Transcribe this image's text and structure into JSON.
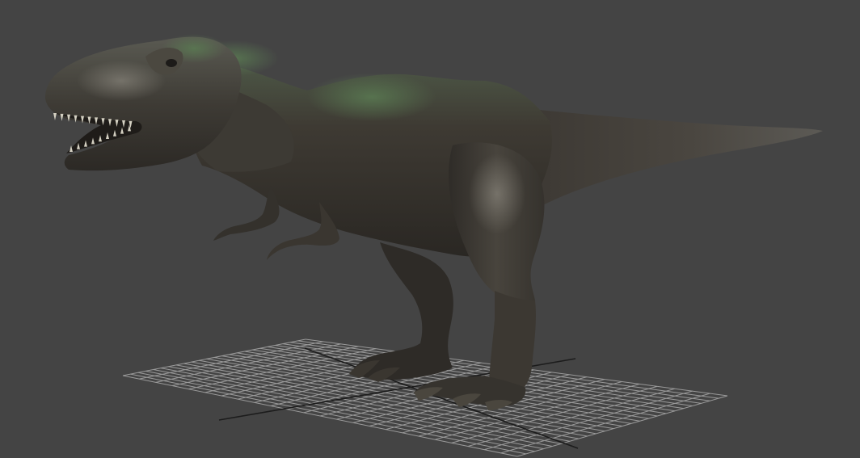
{
  "viewport": {
    "background_color": "#444444",
    "content": "3d-model-preview",
    "model": "tyrannosaurus",
    "ground_grid": {
      "visible": true,
      "line_color": "#9a9a9a",
      "axis_line_color": "#1e1e1e"
    },
    "model_colors": {
      "skin_dark": "#2d2a26",
      "skin_mid": "#4a443c",
      "skin_green": "#4d6b4a",
      "skin_highlight": "#6e6a60"
    }
  }
}
